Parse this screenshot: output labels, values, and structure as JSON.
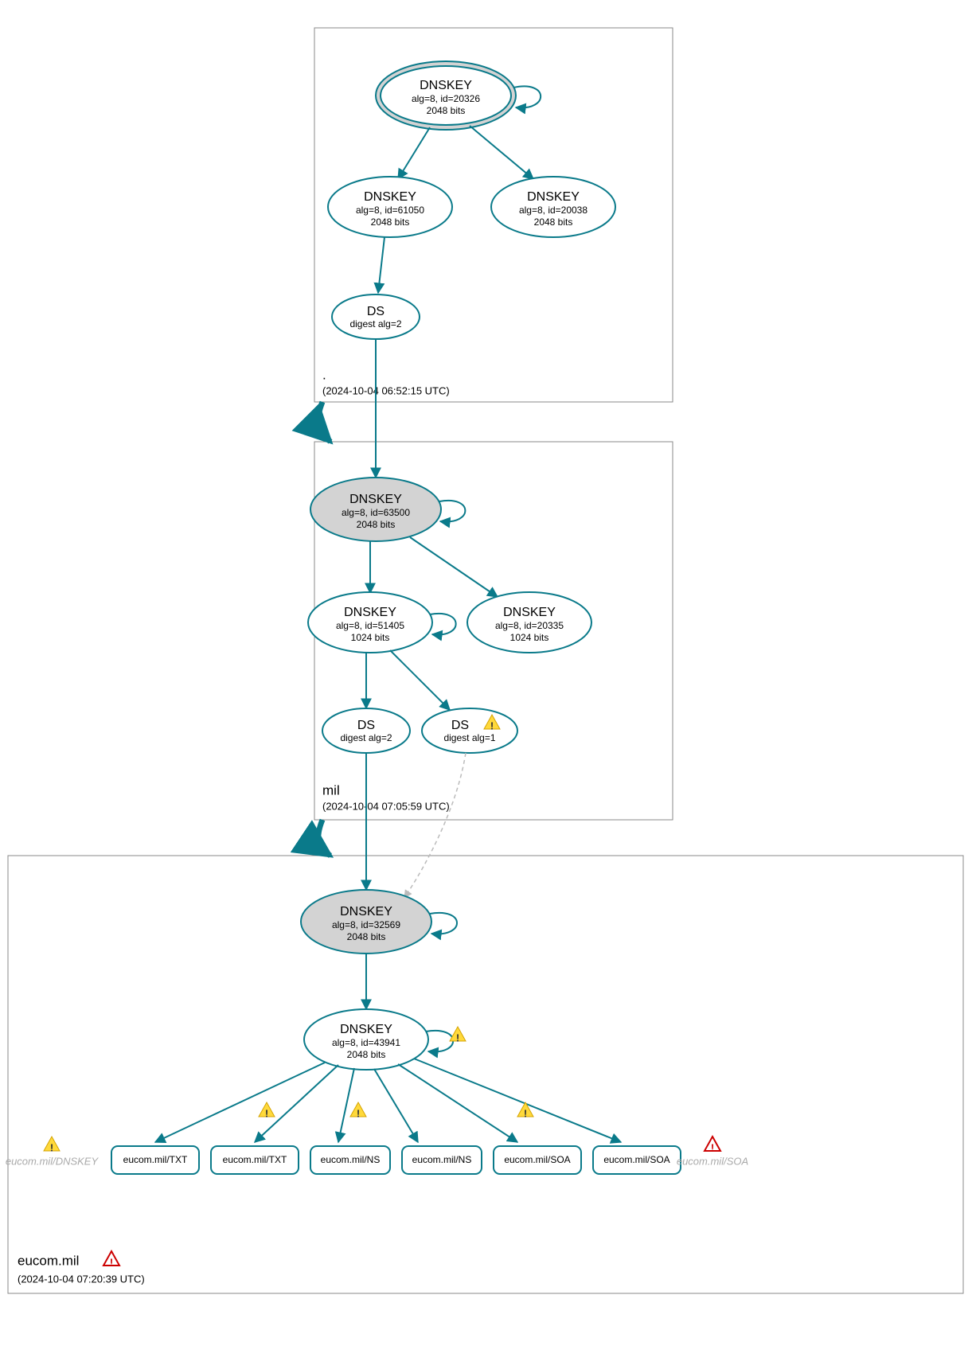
{
  "zones": {
    "root": {
      "name": ".",
      "timestamp": "(2024-10-04 06:52:15 UTC)"
    },
    "mil": {
      "name": "mil",
      "timestamp": "(2024-10-04 07:05:59 UTC)"
    },
    "eucom": {
      "name": "eucom.mil",
      "timestamp": "(2024-10-04 07:20:39 UTC)"
    }
  },
  "nodes": {
    "root_ksk": {
      "t": "DNSKEY",
      "a": "alg=8, id=20326",
      "b": "2048 bits"
    },
    "root_zsk1": {
      "t": "DNSKEY",
      "a": "alg=8, id=61050",
      "b": "2048 bits"
    },
    "root_zsk2": {
      "t": "DNSKEY",
      "a": "alg=8, id=20038",
      "b": "2048 bits"
    },
    "root_ds": {
      "t": "DS",
      "a": "digest alg=2"
    },
    "mil_ksk": {
      "t": "DNSKEY",
      "a": "alg=8, id=63500",
      "b": "2048 bits"
    },
    "mil_zsk1": {
      "t": "DNSKEY",
      "a": "alg=8, id=51405",
      "b": "1024 bits"
    },
    "mil_zsk2": {
      "t": "DNSKEY",
      "a": "alg=8, id=20335",
      "b": "1024 bits"
    },
    "mil_ds1": {
      "t": "DS",
      "a": "digest alg=2"
    },
    "mil_ds2": {
      "t": "DS",
      "a": "digest alg=1"
    },
    "eucom_ksk": {
      "t": "DNSKEY",
      "a": "alg=8, id=32569",
      "b": "2048 bits"
    },
    "eucom_zsk": {
      "t": "DNSKEY",
      "a": "alg=8, id=43941",
      "b": "2048 bits"
    },
    "rr1": "eucom.mil/TXT",
    "rr2": "eucom.mil/TXT",
    "rr3": "eucom.mil/NS",
    "rr4": "eucom.mil/NS",
    "rr5": "eucom.mil/SOA",
    "rr6": "eucom.mil/SOA",
    "ghost1": "eucom.mil/DNSKEY",
    "ghost2": "eucom.mil/SOA"
  }
}
